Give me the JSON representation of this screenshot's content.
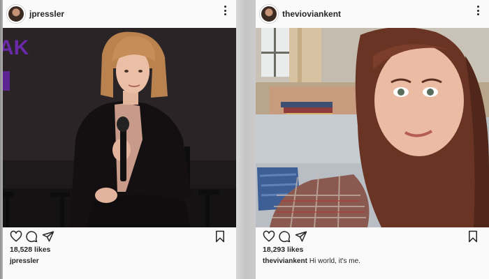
{
  "posts": [
    {
      "username": "jpressler",
      "likes": "18,528 likes",
      "caption_user": "jpressler",
      "caption_text": "",
      "photo_description": "woman with microphone seated on stage",
      "photo_backdrop_text": "AK"
    },
    {
      "username": "thevioviankent",
      "likes": "18,293 likes",
      "caption_user": "theviviankent",
      "caption_text": "Hi world, it's me.",
      "photo_description": "selfie in living room"
    }
  ],
  "icons": {
    "avatar": "avatar",
    "more": "more-icon",
    "like": "heart-icon",
    "comment": "comment-icon",
    "share": "share-icon",
    "save": "bookmark-icon"
  },
  "colors": {
    "card_bg": "#fafafa",
    "text": "#262626",
    "backdrop_purple": "#7b2fbf"
  }
}
